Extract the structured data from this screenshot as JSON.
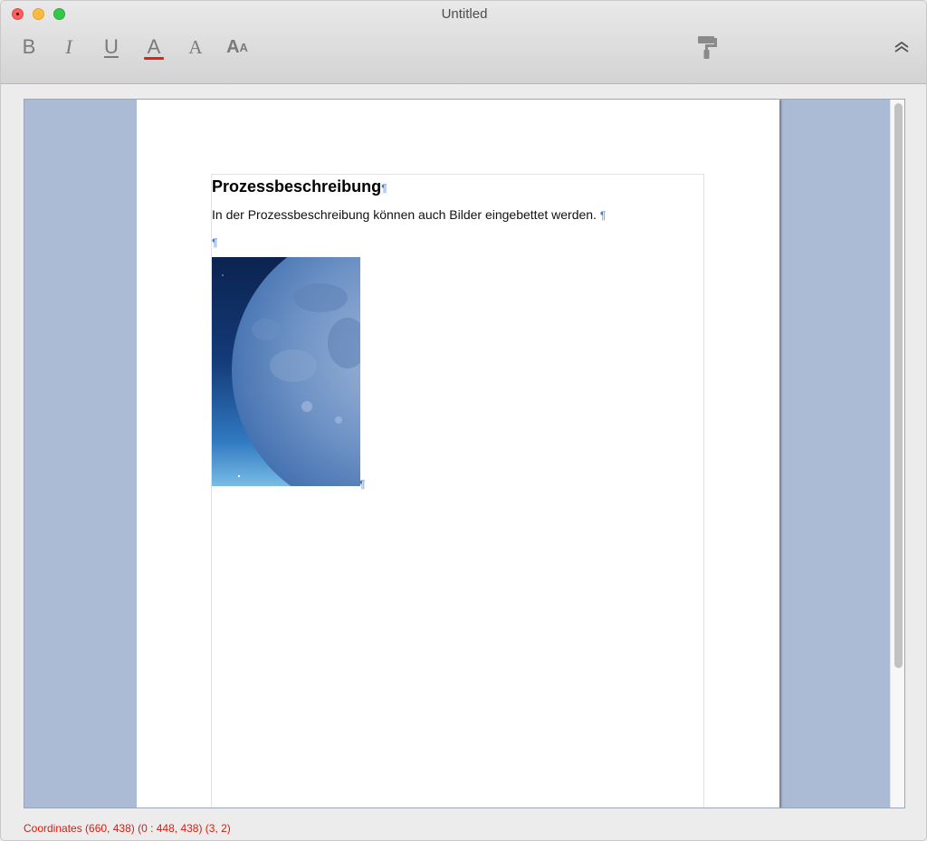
{
  "window": {
    "title": "Untitled"
  },
  "toolbar": {
    "bold_label": "B",
    "italic_label": "I",
    "underline_label": "U",
    "text_color_label": "A",
    "text_color_accent": "#e0201b",
    "font_label": "A",
    "size_big_label": "A",
    "size_small_label": "A",
    "format_painter_icon": "paint-roller-icon",
    "collapse_icon": "double-chevron-up-icon"
  },
  "document": {
    "heading": "Prozessbeschreibung",
    "paragraph": "In der Prozessbeschreibung können auch Bilder eingebettet werden.",
    "pilcrow": "¶",
    "image": "moon-image"
  },
  "status": {
    "coordinates_text": "Coordinates (660, 438) (0 : 448, 438) (3, 2)",
    "color": "#e3170a"
  },
  "colors": {
    "margin_background": "#abbbd5",
    "page_background": "#ffffff",
    "pilcrow": "#4a7bd0"
  }
}
